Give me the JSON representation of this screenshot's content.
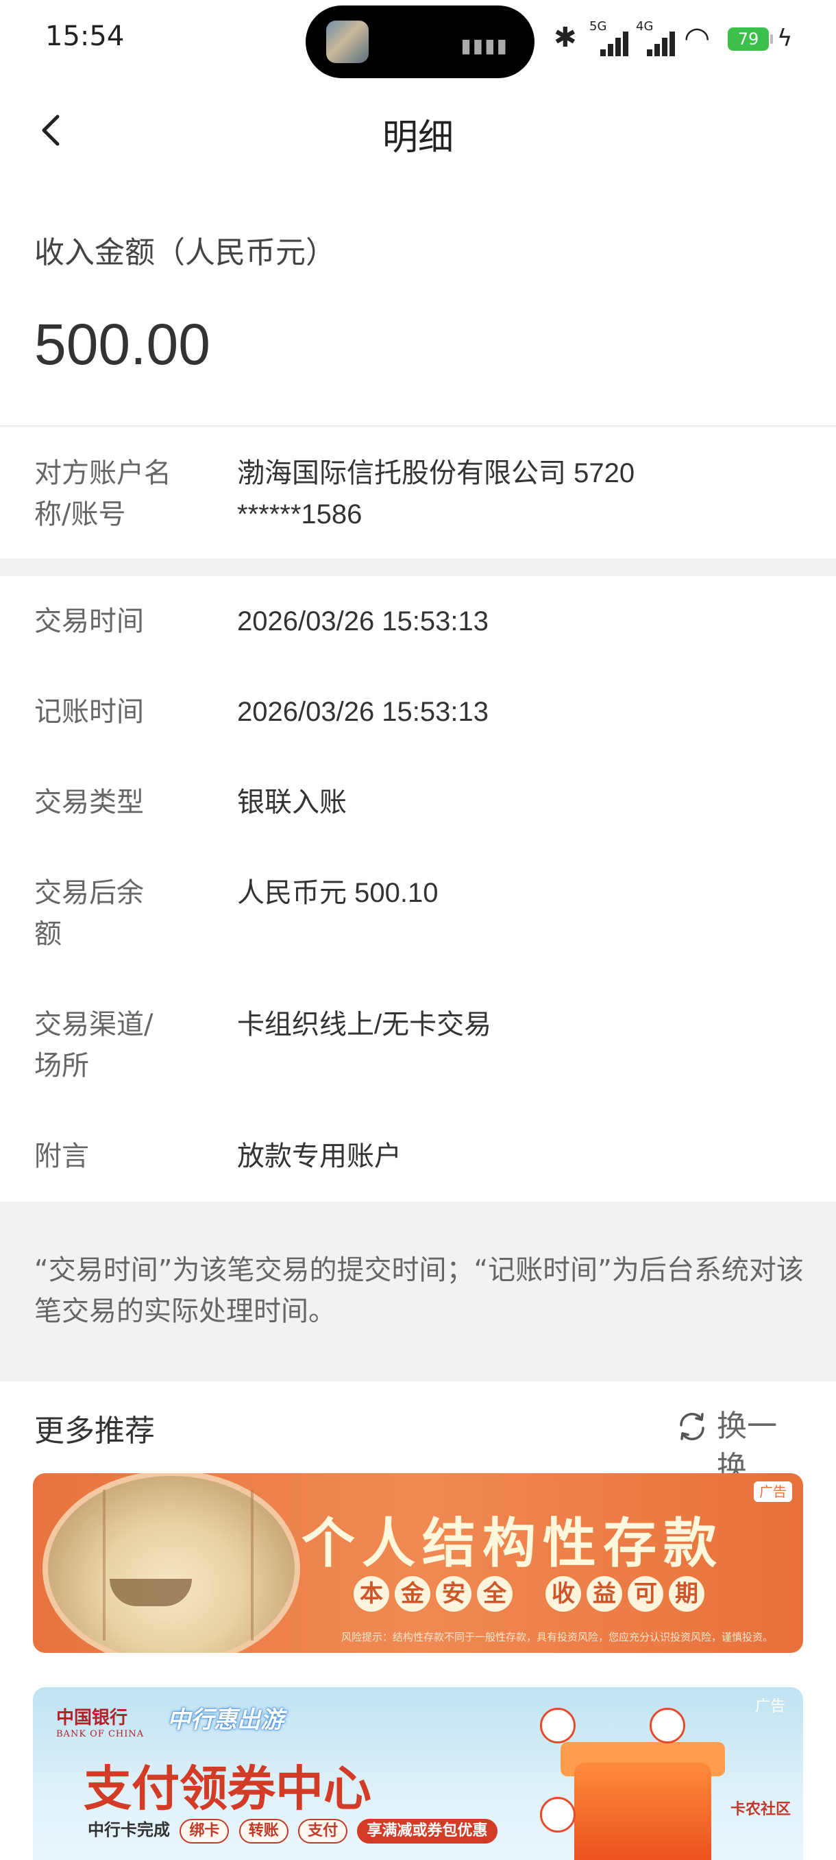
{
  "status_bar": {
    "time": "15:54",
    "bluetooth_icon": "bluetooth-icon",
    "signal_1_label": "5G",
    "signal_2_label": "4G",
    "wifi_icon": "wifi-icon",
    "battery_level": "79",
    "charging_icon": "bolt-icon"
  },
  "nav": {
    "back_icon": "chevron-left-icon",
    "title": "明细"
  },
  "amount": {
    "label": "收入金额（人民币元）",
    "value": "500.00"
  },
  "counterparty": {
    "label": "对方账户名称/账号",
    "value": "渤海国际信托股份有限公司 5720 ******1586"
  },
  "details": [
    {
      "label": "交易时间",
      "value": "2026/03/26 15:53:13"
    },
    {
      "label": "记账时间",
      "value": "2026/03/26 15:53:13"
    },
    {
      "label": "交易类型",
      "value": "银联入账"
    },
    {
      "label": "交易后余额",
      "value": "人民币元 500.10"
    },
    {
      "label": "交易渠道/场所",
      "value": "卡组织线上/无卡交易"
    },
    {
      "label": "附言",
      "value": "放款专用账户"
    }
  ],
  "note": "“交易时间”为该笔交易的提交时间；“记账时间”为后台系统对该笔交易的实际处理时间。",
  "recommend": {
    "title": "更多推荐",
    "refresh_label": "换一换",
    "refresh_icon": "refresh-icon"
  },
  "banners": [
    {
      "ad_tag": "广告",
      "title": "个人结构性存款",
      "pills_1": [
        "本",
        "金",
        "安",
        "全"
      ],
      "pills_2": [
        "收",
        "益",
        "可",
        "期"
      ],
      "risk_note": "风险提示：结构性存款不同于一般性存款，具有投资风险，您应充分认识投资风险，谨慎投资。"
    },
    {
      "ad_tag": "广告",
      "bank_name": "中国银行",
      "bank_name_en": "BANK OF CHINA",
      "brand": "中行惠出游",
      "title": "支付领券中心",
      "sub_lead": "中行卡完成",
      "chips": [
        "绑卡",
        "转账",
        "支付"
      ],
      "chip_highlight": "享满减或券包优惠",
      "watermark": "卡农社区"
    }
  ],
  "colors": {
    "banner1_bg": "#e8703a",
    "banner2_title": "#d23b26",
    "battery": "#3bc14a"
  }
}
